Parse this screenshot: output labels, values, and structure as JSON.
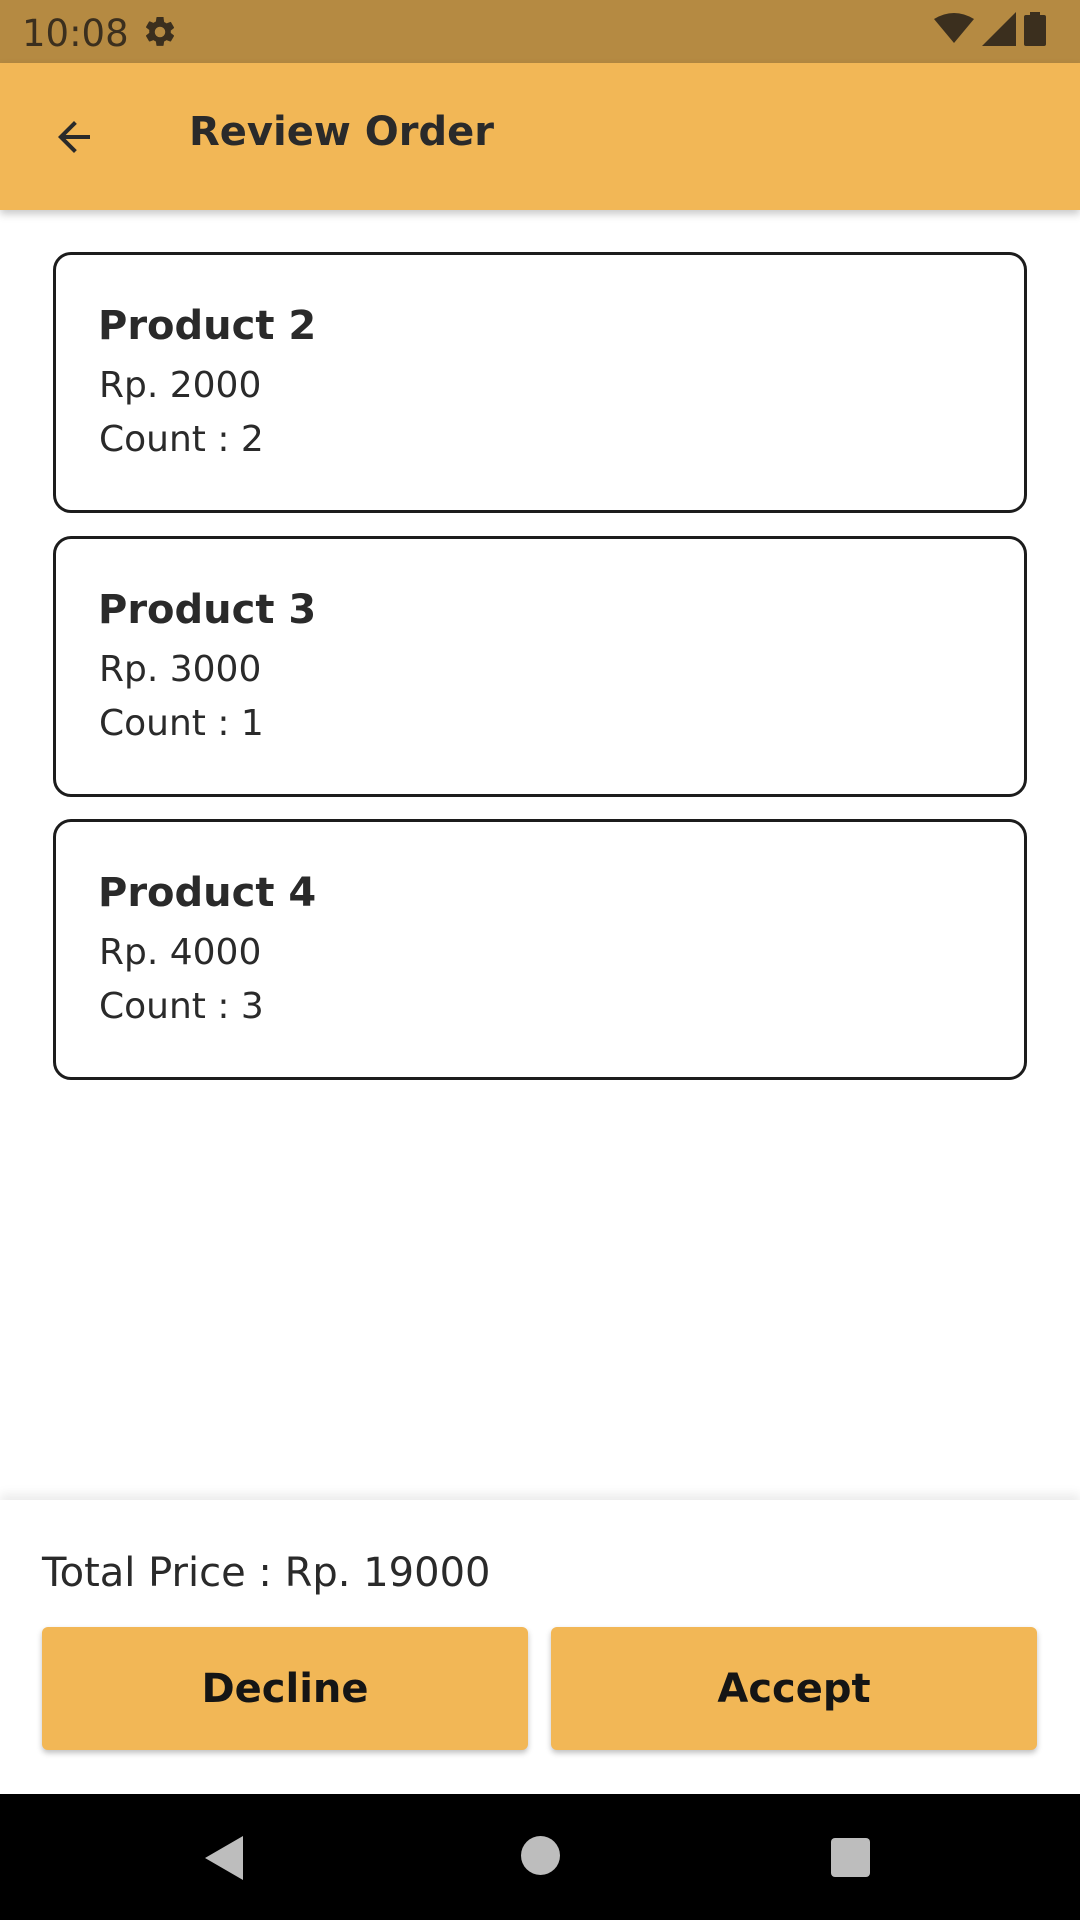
{
  "status_bar": {
    "time": "10:08",
    "icons": [
      "gear-icon",
      "wifi-icon",
      "signal-icon",
      "battery-icon"
    ]
  },
  "app_bar": {
    "title": "Review Order",
    "back_icon": "arrow-back-icon"
  },
  "order_items": [
    {
      "name": "Product 2",
      "price": "Rp. 2000",
      "count": "Count : 2"
    },
    {
      "name": "Product 3",
      "price": "Rp. 3000",
      "count": "Count : 1"
    },
    {
      "name": "Product 4",
      "price": "Rp. 4000",
      "count": "Count : 3"
    }
  ],
  "summary": {
    "total_price": "Total Price : Rp. 19000",
    "decline_label": "Decline",
    "accept_label": "Accept"
  },
  "colors": {
    "status_bar": "#b58a42",
    "accent": "#f2b756"
  }
}
